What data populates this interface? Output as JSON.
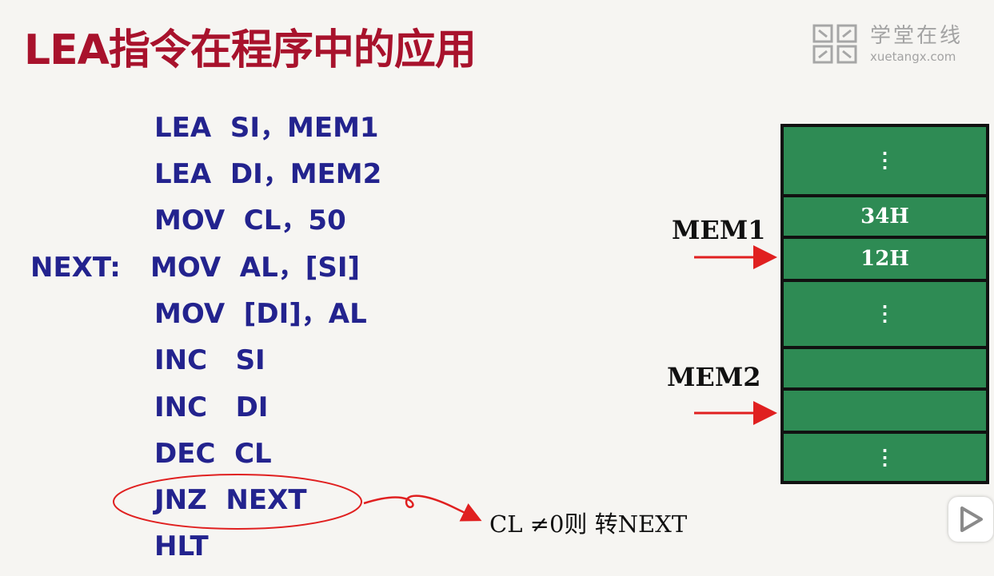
{
  "slide": {
    "title": "LEA指令在程序中的应用"
  },
  "watermark": {
    "name": "学堂在线",
    "url": "xuetangx.com"
  },
  "code": {
    "label": "NEXT:",
    "lines": [
      "LEA  SI，MEM1",
      "LEA  DI，MEM2",
      "MOV  CL，50",
      "MOV  AL，[SI]",
      "MOV  [DI]，AL",
      "INC   SI",
      "INC   DI",
      "DEC  CL",
      "JNZ  NEXT",
      "HLT"
    ]
  },
  "memory": {
    "labels": [
      "MEM1",
      "MEM2"
    ],
    "cells": [
      "⋮",
      "34H",
      "12H",
      "⋮",
      "",
      "",
      "⋮"
    ]
  },
  "annotation": {
    "note": "CL ≠0则 转NEXT"
  },
  "colors": {
    "title": "#a8122c",
    "code": "#23238e",
    "cell": "#2e8b54",
    "arrow": "#e02020"
  },
  "icons": {
    "watermark_logo": "xuetangx-logo-icon",
    "play": "play-icon"
  }
}
